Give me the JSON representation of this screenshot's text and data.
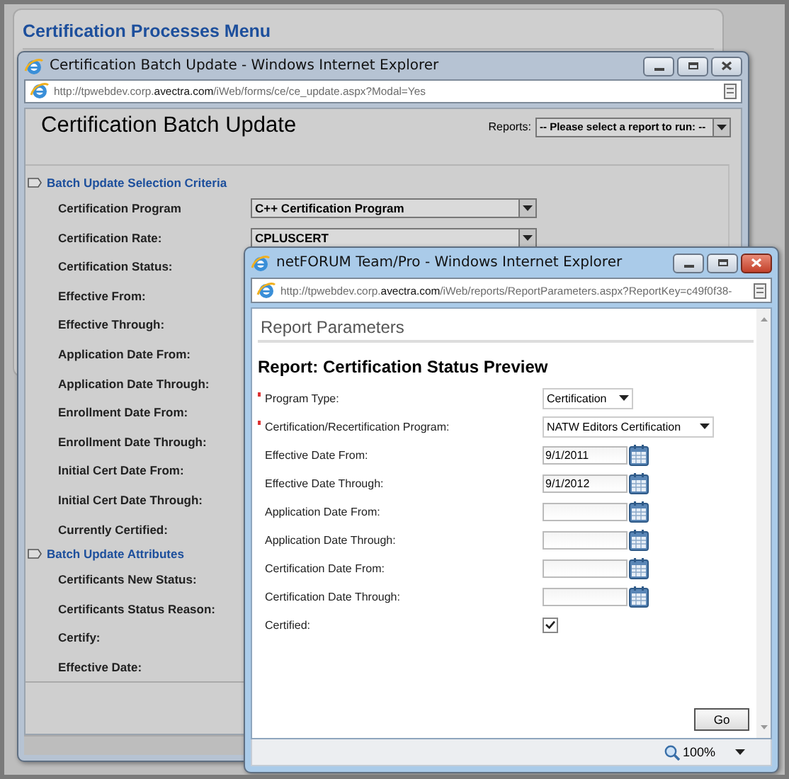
{
  "menu": {
    "title": "Certification Processes Menu"
  },
  "batch_window": {
    "title": "Certification Batch Update - Windows Internet Explorer",
    "address": "http://tpwebdev.corp.**avectra.com**/iWeb/forms/ce/ce_update.aspx?Modal=Yes",
    "active": false,
    "heading": "Certification Batch Update",
    "reports": {
      "label": "Reports:",
      "value": "-- Please select a report to run: --"
    },
    "sections": [
      {
        "title": "Batch Update Selection Criteria",
        "fields": [
          {
            "label": "Certification Program",
            "value": "C++ Certification Program"
          },
          {
            "label": "Certification Rate:",
            "value": "CPLUSCERT"
          },
          {
            "label": "Certification Status:"
          },
          {
            "label": "Effective From:"
          },
          {
            "label": "Effective Through:"
          },
          {
            "label": "Application Date From:"
          },
          {
            "label": "Application Date Through:"
          },
          {
            "label": "Enrollment Date From:"
          },
          {
            "label": "Enrollment Date Through:"
          },
          {
            "label": "Initial Cert Date From:"
          },
          {
            "label": "Initial Cert Date Through:"
          },
          {
            "label": "Currently Certified:"
          }
        ]
      },
      {
        "title": "Batch Update Attributes",
        "fields": [
          {
            "label": "Certificants New Status:"
          },
          {
            "label": "Certificants Status Reason:"
          },
          {
            "label": "Certify:"
          },
          {
            "label": "Effective Date:"
          }
        ]
      }
    ]
  },
  "report_window": {
    "title": "netFORUM Team/Pro - Windows Internet Explorer",
    "address": "http://tpwebdev.corp.**avectra.com**/iWeb/reports/ReportParameters.aspx?ReportKey=c49f0f38-",
    "active": true,
    "section_title": "Report Parameters",
    "heading": "Report: Certification Status Preview",
    "fields": [
      {
        "kind": "select",
        "label": "Program Type:",
        "required": true,
        "value": "Certification"
      },
      {
        "kind": "select",
        "label": "Certification/Recertification Program:",
        "required": true,
        "value": "NATW Editors Certification"
      },
      {
        "kind": "date",
        "label": "Effective Date From:",
        "required": false,
        "value": "9/1/2011"
      },
      {
        "kind": "date",
        "label": "Effective Date Through:",
        "required": false,
        "value": "9/1/2012"
      },
      {
        "kind": "date",
        "label": "Application Date From:",
        "required": false
      },
      {
        "kind": "date",
        "label": "Application Date Through:",
        "required": false
      },
      {
        "kind": "date",
        "label": "Certification Date From:",
        "required": false
      },
      {
        "kind": "date",
        "label": "Certification Date Through:",
        "required": false
      },
      {
        "kind": "checkbox",
        "label": "Certified:",
        "required": false,
        "checked": true
      }
    ],
    "button": "Go",
    "zoom": "100%"
  }
}
